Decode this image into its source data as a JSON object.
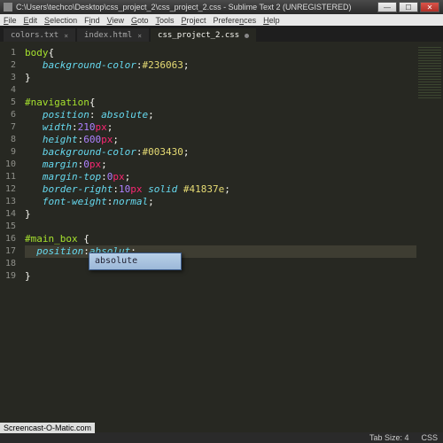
{
  "window": {
    "title": "C:\\Users\\techco\\Desktop\\css_project_2\\css_project_2.css - Sublime Text 2 (UNREGISTERED)"
  },
  "menu": {
    "items": [
      "File",
      "Edit",
      "Selection",
      "Find",
      "View",
      "Goto",
      "Tools",
      "Project",
      "Preferences",
      "Help"
    ]
  },
  "tabs": [
    {
      "label": "colors.txt",
      "active": false,
      "dirty": false
    },
    {
      "label": "index.html",
      "active": false,
      "dirty": false
    },
    {
      "label": "css_project_2.css",
      "active": true,
      "dirty": true
    }
  ],
  "gutter": [
    "1",
    "2",
    "3",
    "4",
    "5",
    "6",
    "7",
    "8",
    "9",
    "10",
    "11",
    "12",
    "13",
    "14",
    "15",
    "16",
    "17",
    "18",
    "19"
  ],
  "code": {
    "l1_sel": "body",
    "l1_punc": "{",
    "l2_prop": "background-color",
    "l2_val": "#236063",
    "l3": "}",
    "l5_sel": "#navigation",
    "l5_punc": "{",
    "l6_prop": "position",
    "l6_val": "absolute",
    "l7_prop": "width",
    "l7_num": "210",
    "l7_unit": "px",
    "l8_prop": "height",
    "l8_num": "600",
    "l8_unit": "px",
    "l9_prop": "background-color",
    "l9_val": "#003430",
    "l10_prop": "margin",
    "l10_num": "0",
    "l10_unit": "px",
    "l11_prop": "margin-top",
    "l11_num": "0",
    "l11_unit": "px",
    "l12_prop": "border-right",
    "l12_num": "10",
    "l12_unit": "px",
    "l12_kw": "solid",
    "l12_col": "#41837e",
    "l13_prop": "font-weight",
    "l13_val": "normal",
    "l14": "}",
    "l16_sel": "#main_box",
    "l16_punc": " {",
    "l17_prop": "position",
    "l17_val": "absolut",
    "l19": "}"
  },
  "autocomplete": {
    "item": "absolute"
  },
  "status": {
    "tabsize": "Tab Size: 4",
    "syntax": "CSS"
  },
  "watermark": "Screencast-O-Matic.com"
}
